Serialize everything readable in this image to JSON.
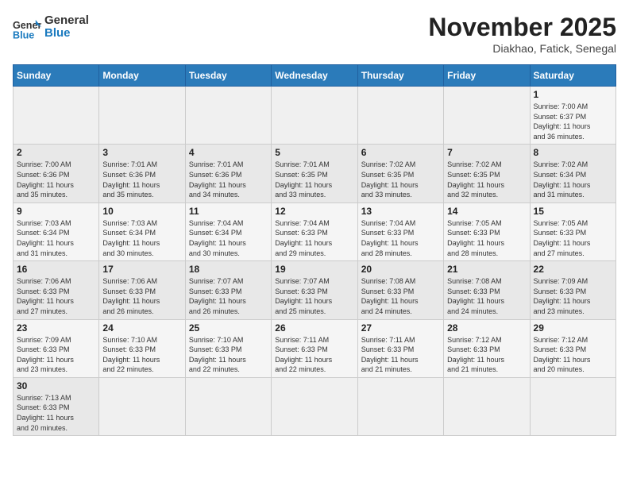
{
  "header": {
    "logo_general": "General",
    "logo_blue": "Blue",
    "month_title": "November 2025",
    "location": "Diakhao, Fatick, Senegal"
  },
  "days_of_week": [
    "Sunday",
    "Monday",
    "Tuesday",
    "Wednesday",
    "Thursday",
    "Friday",
    "Saturday"
  ],
  "weeks": [
    [
      {
        "day": "",
        "info": ""
      },
      {
        "day": "",
        "info": ""
      },
      {
        "day": "",
        "info": ""
      },
      {
        "day": "",
        "info": ""
      },
      {
        "day": "",
        "info": ""
      },
      {
        "day": "",
        "info": ""
      },
      {
        "day": "1",
        "info": "Sunrise: 7:00 AM\nSunset: 6:37 PM\nDaylight: 11 hours\nand 36 minutes."
      }
    ],
    [
      {
        "day": "2",
        "info": "Sunrise: 7:00 AM\nSunset: 6:36 PM\nDaylight: 11 hours\nand 35 minutes."
      },
      {
        "day": "3",
        "info": "Sunrise: 7:01 AM\nSunset: 6:36 PM\nDaylight: 11 hours\nand 35 minutes."
      },
      {
        "day": "4",
        "info": "Sunrise: 7:01 AM\nSunset: 6:36 PM\nDaylight: 11 hours\nand 34 minutes."
      },
      {
        "day": "5",
        "info": "Sunrise: 7:01 AM\nSunset: 6:35 PM\nDaylight: 11 hours\nand 33 minutes."
      },
      {
        "day": "6",
        "info": "Sunrise: 7:02 AM\nSunset: 6:35 PM\nDaylight: 11 hours\nand 33 minutes."
      },
      {
        "day": "7",
        "info": "Sunrise: 7:02 AM\nSunset: 6:35 PM\nDaylight: 11 hours\nand 32 minutes."
      },
      {
        "day": "8",
        "info": "Sunrise: 7:02 AM\nSunset: 6:34 PM\nDaylight: 11 hours\nand 31 minutes."
      }
    ],
    [
      {
        "day": "9",
        "info": "Sunrise: 7:03 AM\nSunset: 6:34 PM\nDaylight: 11 hours\nand 31 minutes."
      },
      {
        "day": "10",
        "info": "Sunrise: 7:03 AM\nSunset: 6:34 PM\nDaylight: 11 hours\nand 30 minutes."
      },
      {
        "day": "11",
        "info": "Sunrise: 7:04 AM\nSunset: 6:34 PM\nDaylight: 11 hours\nand 30 minutes."
      },
      {
        "day": "12",
        "info": "Sunrise: 7:04 AM\nSunset: 6:33 PM\nDaylight: 11 hours\nand 29 minutes."
      },
      {
        "day": "13",
        "info": "Sunrise: 7:04 AM\nSunset: 6:33 PM\nDaylight: 11 hours\nand 28 minutes."
      },
      {
        "day": "14",
        "info": "Sunrise: 7:05 AM\nSunset: 6:33 PM\nDaylight: 11 hours\nand 28 minutes."
      },
      {
        "day": "15",
        "info": "Sunrise: 7:05 AM\nSunset: 6:33 PM\nDaylight: 11 hours\nand 27 minutes."
      }
    ],
    [
      {
        "day": "16",
        "info": "Sunrise: 7:06 AM\nSunset: 6:33 PM\nDaylight: 11 hours\nand 27 minutes."
      },
      {
        "day": "17",
        "info": "Sunrise: 7:06 AM\nSunset: 6:33 PM\nDaylight: 11 hours\nand 26 minutes."
      },
      {
        "day": "18",
        "info": "Sunrise: 7:07 AM\nSunset: 6:33 PM\nDaylight: 11 hours\nand 26 minutes."
      },
      {
        "day": "19",
        "info": "Sunrise: 7:07 AM\nSunset: 6:33 PM\nDaylight: 11 hours\nand 25 minutes."
      },
      {
        "day": "20",
        "info": "Sunrise: 7:08 AM\nSunset: 6:33 PM\nDaylight: 11 hours\nand 24 minutes."
      },
      {
        "day": "21",
        "info": "Sunrise: 7:08 AM\nSunset: 6:33 PM\nDaylight: 11 hours\nand 24 minutes."
      },
      {
        "day": "22",
        "info": "Sunrise: 7:09 AM\nSunset: 6:33 PM\nDaylight: 11 hours\nand 23 minutes."
      }
    ],
    [
      {
        "day": "23",
        "info": "Sunrise: 7:09 AM\nSunset: 6:33 PM\nDaylight: 11 hours\nand 23 minutes."
      },
      {
        "day": "24",
        "info": "Sunrise: 7:10 AM\nSunset: 6:33 PM\nDaylight: 11 hours\nand 22 minutes."
      },
      {
        "day": "25",
        "info": "Sunrise: 7:10 AM\nSunset: 6:33 PM\nDaylight: 11 hours\nand 22 minutes."
      },
      {
        "day": "26",
        "info": "Sunrise: 7:11 AM\nSunset: 6:33 PM\nDaylight: 11 hours\nand 22 minutes."
      },
      {
        "day": "27",
        "info": "Sunrise: 7:11 AM\nSunset: 6:33 PM\nDaylight: 11 hours\nand 21 minutes."
      },
      {
        "day": "28",
        "info": "Sunrise: 7:12 AM\nSunset: 6:33 PM\nDaylight: 11 hours\nand 21 minutes."
      },
      {
        "day": "29",
        "info": "Sunrise: 7:12 AM\nSunset: 6:33 PM\nDaylight: 11 hours\nand 20 minutes."
      }
    ],
    [
      {
        "day": "30",
        "info": "Sunrise: 7:13 AM\nSunset: 6:33 PM\nDaylight: 11 hours\nand 20 minutes."
      },
      {
        "day": "",
        "info": ""
      },
      {
        "day": "",
        "info": ""
      },
      {
        "day": "",
        "info": ""
      },
      {
        "day": "",
        "info": ""
      },
      {
        "day": "",
        "info": ""
      },
      {
        "day": "",
        "info": ""
      }
    ]
  ]
}
